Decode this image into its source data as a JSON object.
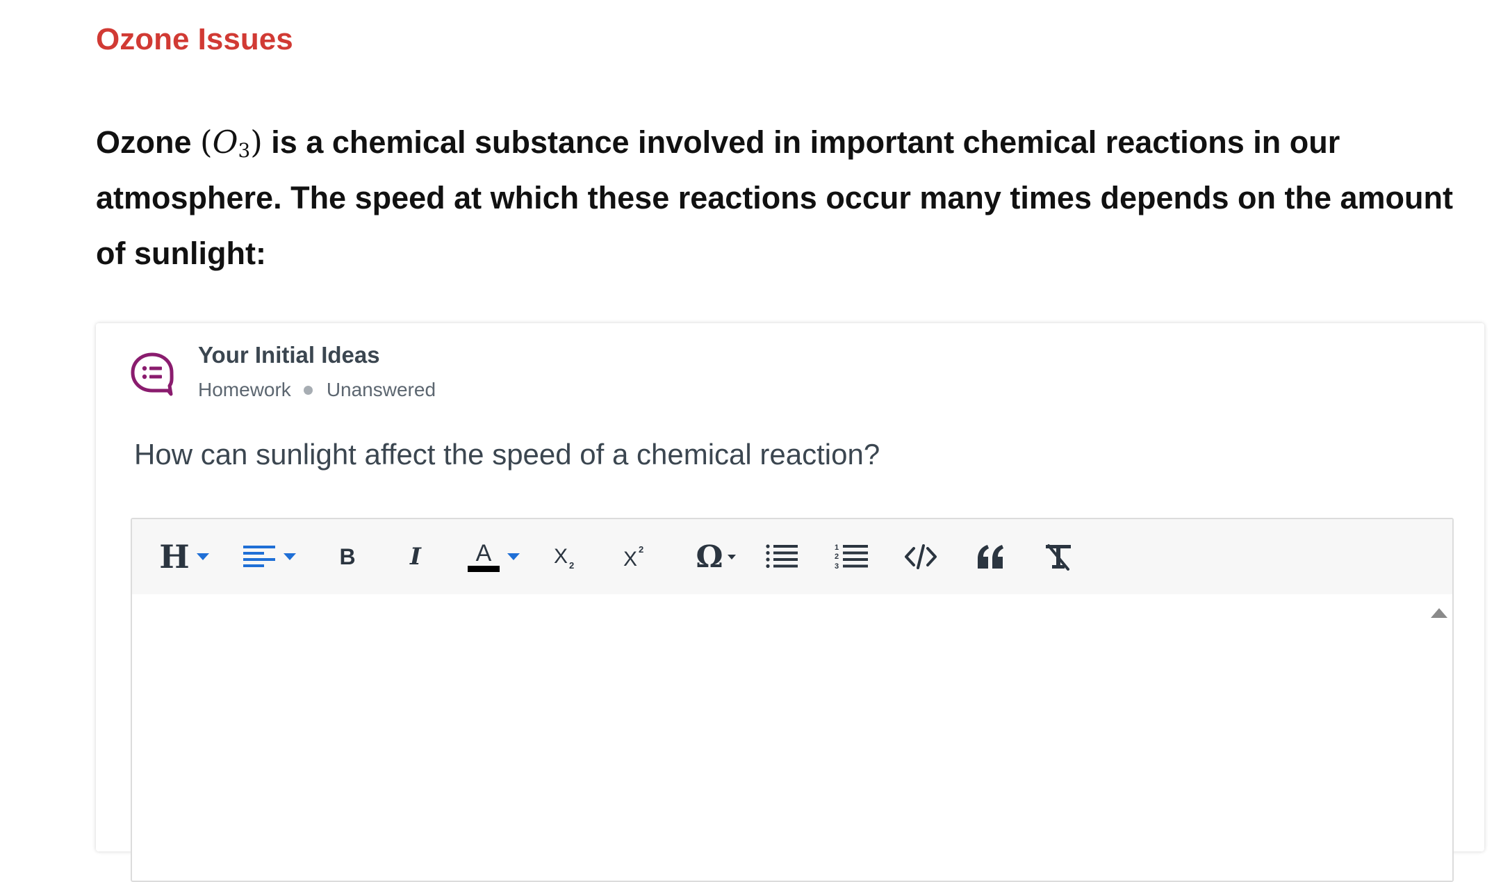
{
  "section": {
    "title": "Ozone Issues"
  },
  "intro": {
    "before": "Ozone ",
    "math_open": "(",
    "math_symbol": "O",
    "math_subscript": "3",
    "math_close": ")",
    "after": " is a chemical substance involved in important chemical reactions in our atmosphere. The speed at which these reactions occur many times depends on the amount of sunlight:"
  },
  "card": {
    "title": "Your Initial Ideas",
    "meta_type": "Homework",
    "meta_status": "Unanswered",
    "question": "How can sunlight affect the speed of a chemical reaction?",
    "icon_color": "#8a1c6e"
  },
  "editor": {
    "toolbar": {
      "heading": "H",
      "bold": "B",
      "italic": "I",
      "font_color": "A",
      "subscript": "X",
      "superscript": "X",
      "special_chars": "Ω",
      "accent_color": "#1f6fd6"
    },
    "content": ""
  }
}
